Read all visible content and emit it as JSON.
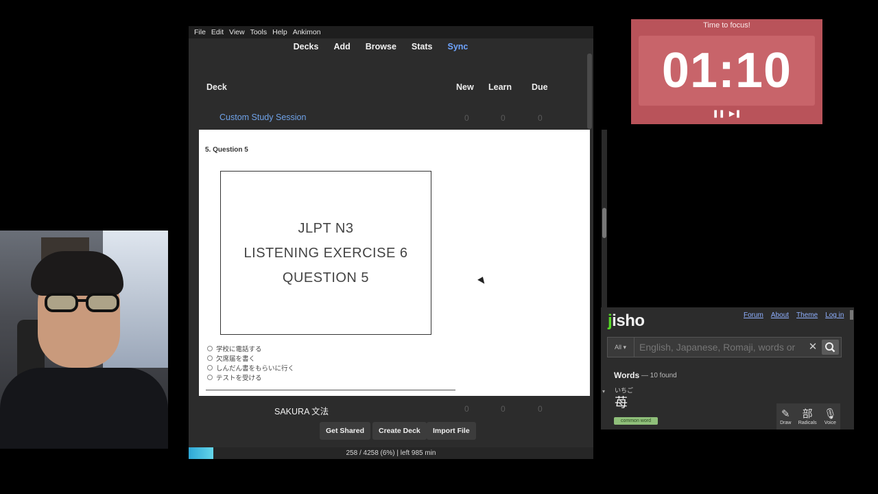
{
  "anki": {
    "menu": [
      "File",
      "Edit",
      "View",
      "Tools",
      "Help",
      "Ankimon"
    ],
    "toolbar": [
      "Decks",
      "Add",
      "Browse",
      "Stats",
      "Sync"
    ],
    "columns": {
      "deck": "Deck",
      "new": "New",
      "learn": "Learn",
      "due": "Due"
    },
    "decks": [
      {
        "name": "Custom Study Session",
        "new": "0",
        "learn": "0",
        "due": "0"
      },
      {
        "name": "SAKURA 文法",
        "new": "0",
        "learn": "0",
        "due": "0"
      }
    ],
    "buttons": [
      "Get Shared",
      "Create Deck",
      "Import File"
    ],
    "status": "258 / 4258 (6%) | left 985 min",
    "progress_fraction": 0.06
  },
  "quiz": {
    "title": "5. Question 5",
    "image_lines": [
      "JLPT N3",
      "LISTENING EXERCISE 6",
      "QUESTION 5"
    ],
    "options": [
      "学校に電話する",
      "欠席届を書く",
      "しんだん書をもらいに行く",
      "テストを受ける"
    ]
  },
  "timer": {
    "label": "Time to focus!",
    "time": "01:10",
    "controls": [
      "pause-icon",
      "skip-icon"
    ],
    "color": "#b9535a"
  },
  "jisho": {
    "logo": "jisho",
    "links": [
      "Forum",
      "About",
      "Theme",
      "Log in"
    ],
    "filter": "All",
    "placeholder": "English, Japanese, Romaji, words or",
    "words_label": "Words",
    "found": "— 10 found",
    "reading": "いちご",
    "kanji": "苺",
    "badge": "common word",
    "tools": [
      {
        "icon": "draw-icon",
        "label": "Draw"
      },
      {
        "icon": "radicals-icon",
        "label": "Radicals"
      },
      {
        "icon": "voice-icon",
        "label": "Voice"
      }
    ]
  }
}
